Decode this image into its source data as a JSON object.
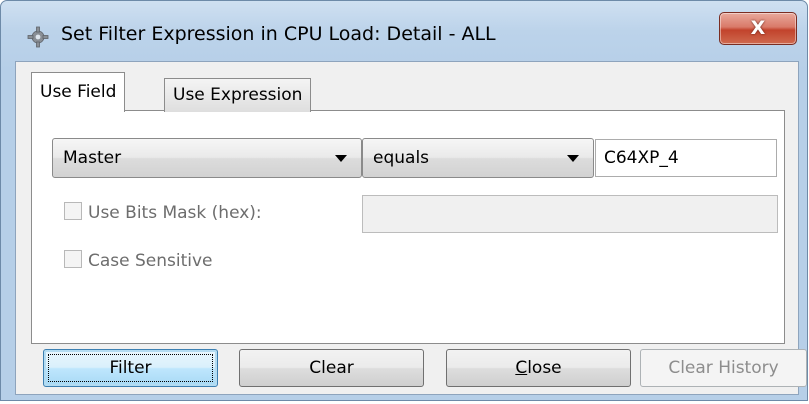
{
  "window": {
    "title": "Set Filter Expression in CPU Load: Detail - ALL",
    "close_glyph": "X",
    "app_icon": "gear-icon"
  },
  "tabs": [
    {
      "label": "Use Field",
      "active": true
    },
    {
      "label": "Use Expression",
      "active": false
    }
  ],
  "field_combo": {
    "value": "Master"
  },
  "operator_combo": {
    "value": "equals"
  },
  "value_input": {
    "value": "C64XP_4"
  },
  "options": {
    "bits_mask_label": "Use Bits Mask (hex):",
    "bits_mask_checked": false,
    "bits_mask_value": "",
    "case_sensitive_label": "Case Sensitive",
    "case_sensitive_checked": false
  },
  "buttons": {
    "filter": "Filter",
    "clear": "Clear",
    "close_first": "C",
    "close_rest": "lose",
    "clear_history": "Clear History"
  },
  "colors": {
    "title_bar": "#bcd3ea",
    "close_button": "#c2432c",
    "default_button": "#bee6fd"
  }
}
